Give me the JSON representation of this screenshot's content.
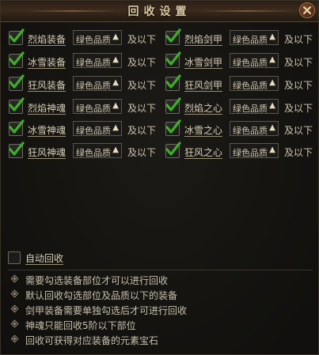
{
  "window": {
    "title": "回收设置",
    "close_icon": "close-icon"
  },
  "items": [
    {
      "label": "烈焰装备",
      "quality": "绿色品质",
      "suffix": "及以下",
      "checked": true
    },
    {
      "label": "烈焰剑甲",
      "quality": "绿色品质",
      "suffix": "及以下",
      "checked": true
    },
    {
      "label": "冰雪装备",
      "quality": "绿色品质",
      "suffix": "及以下",
      "checked": true
    },
    {
      "label": "冰雪剑甲",
      "quality": "绿色品质",
      "suffix": "及以下",
      "checked": true
    },
    {
      "label": "狂风装备",
      "quality": "绿色品质",
      "suffix": "及以下",
      "checked": true
    },
    {
      "label": "狂风剑甲",
      "quality": "绿色品质",
      "suffix": "及以下",
      "checked": true
    },
    {
      "label": "烈焰神魂",
      "quality": "绿色品质",
      "suffix": "及以下",
      "checked": true
    },
    {
      "label": "烈焰之心",
      "quality": "绿色品质",
      "suffix": "及以下",
      "checked": true
    },
    {
      "label": "冰雪神魂",
      "quality": "绿色品质",
      "suffix": "及以下",
      "checked": true
    },
    {
      "label": "冰雪之心",
      "quality": "绿色品质",
      "suffix": "及以下",
      "checked": true
    },
    {
      "label": "狂风神魂",
      "quality": "绿色品质",
      "suffix": "及以下",
      "checked": true
    },
    {
      "label": "狂风之心",
      "quality": "绿色品质",
      "suffix": "及以下",
      "checked": true
    }
  ],
  "auto_recycle": {
    "label": "自动回收",
    "checked": false
  },
  "notes": [
    "需要勾选装备部位才可以进行回收",
    "默认回收勾选部位及品质以下的装备",
    "剑甲装备需要单独勾选后才可进行回收",
    "神魂只能回收5阶以下部位",
    "回收可获得对应装备的元素宝石"
  ],
  "colors": {
    "check": "#3fae2a",
    "label": "#d8cfb6",
    "title": "#d9c8a0"
  }
}
